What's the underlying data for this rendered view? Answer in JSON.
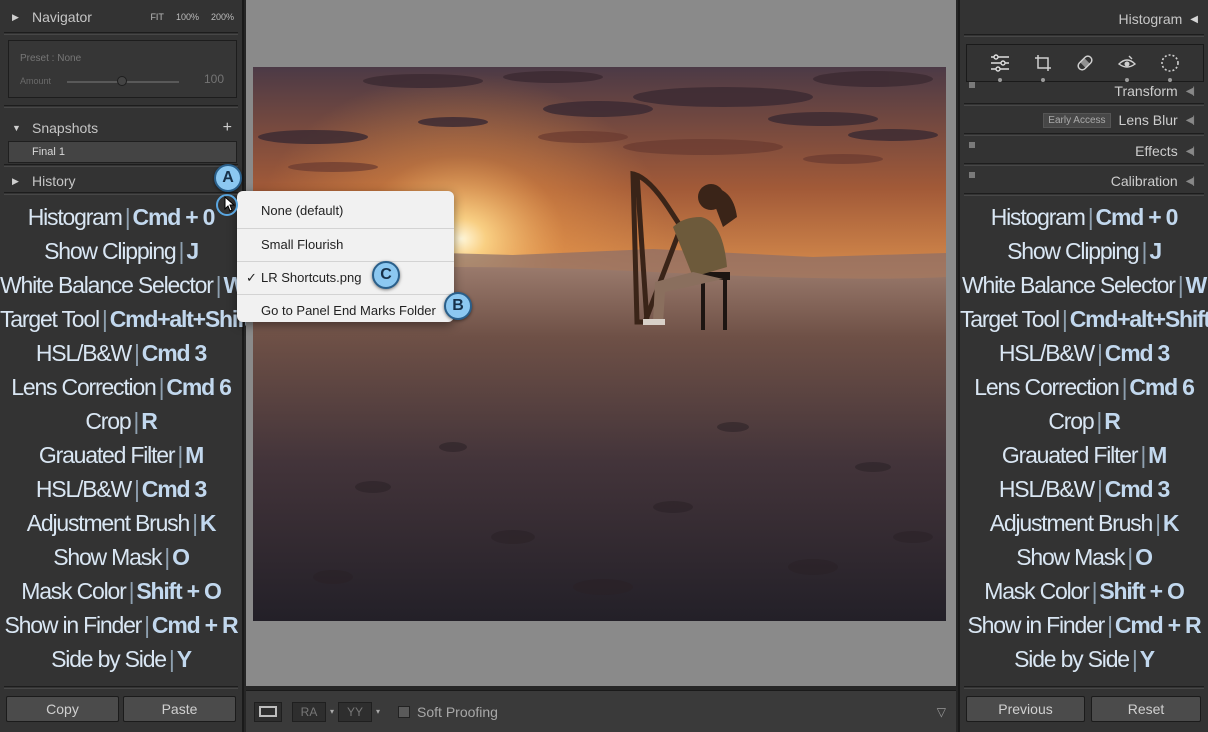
{
  "navigator": {
    "title": "Navigator",
    "fit": "FIT",
    "zoom1": "100%",
    "zoom2": "200%",
    "preset_label": "Preset : None",
    "amount_label": "Amount",
    "amount_value": "100"
  },
  "snapshots": {
    "title": "Snapshots",
    "add": "+",
    "item": "Final 1"
  },
  "history": {
    "title": "History"
  },
  "shortcuts": [
    {
      "label": "Histogram",
      "key": "Cmd + 0"
    },
    {
      "label": "Show Clipping",
      "key": "J"
    },
    {
      "label": "White Balance Selector",
      "key": "W"
    },
    {
      "label": "Target Tool",
      "key": "Cmd+alt+Shift"
    },
    {
      "label": "HSL/B&W",
      "key": "Cmd 3"
    },
    {
      "label": "Lens Correction",
      "key": "Cmd 6"
    },
    {
      "label": "Crop",
      "key": "R"
    },
    {
      "label": "Grauated Filter",
      "key": "M"
    },
    {
      "label": "HSL/B&W",
      "key": "Cmd 3"
    },
    {
      "label": "Adjustment Brush",
      "key": "K"
    },
    {
      "label": "Show Mask",
      "key": "O"
    },
    {
      "label": "Mask Color",
      "key": "Shift + O"
    },
    {
      "label": "Show in Finder",
      "key": "Cmd + R"
    },
    {
      "label": "Side by Side",
      "key": "Y"
    }
  ],
  "left_buttons": {
    "copy": "Copy",
    "paste": "Paste"
  },
  "right_panel": {
    "histogram": "Histogram",
    "sections": {
      "transform": "Transform",
      "early_access": "Early Access",
      "lens_blur": "Lens Blur",
      "effects": "Effects",
      "calibration": "Calibration"
    },
    "tools": [
      "edit-sliders-icon",
      "crop-icon",
      "healing-bandage-icon",
      "red-eye-icon",
      "masking-circle-icon"
    ],
    "previous": "Previous",
    "reset": "Reset"
  },
  "toolbar": {
    "view1": "RA",
    "view2": "YY",
    "soft_proofing": "Soft Proofing"
  },
  "menu": {
    "items": [
      {
        "label": "None (default)",
        "checked": false
      },
      {
        "label": "Small Flourish",
        "checked": false
      },
      {
        "label": "LR Shortcuts.png",
        "checked": true
      },
      {
        "label": "Go to Panel End Marks Folder",
        "checked": false
      }
    ],
    "check": "✓"
  },
  "badges": {
    "a": "A",
    "b": "B",
    "c": "C"
  },
  "colors": {
    "badge": "#8cc8f1",
    "panel": "#333333",
    "shortcut_text": "#d9e6f3"
  }
}
